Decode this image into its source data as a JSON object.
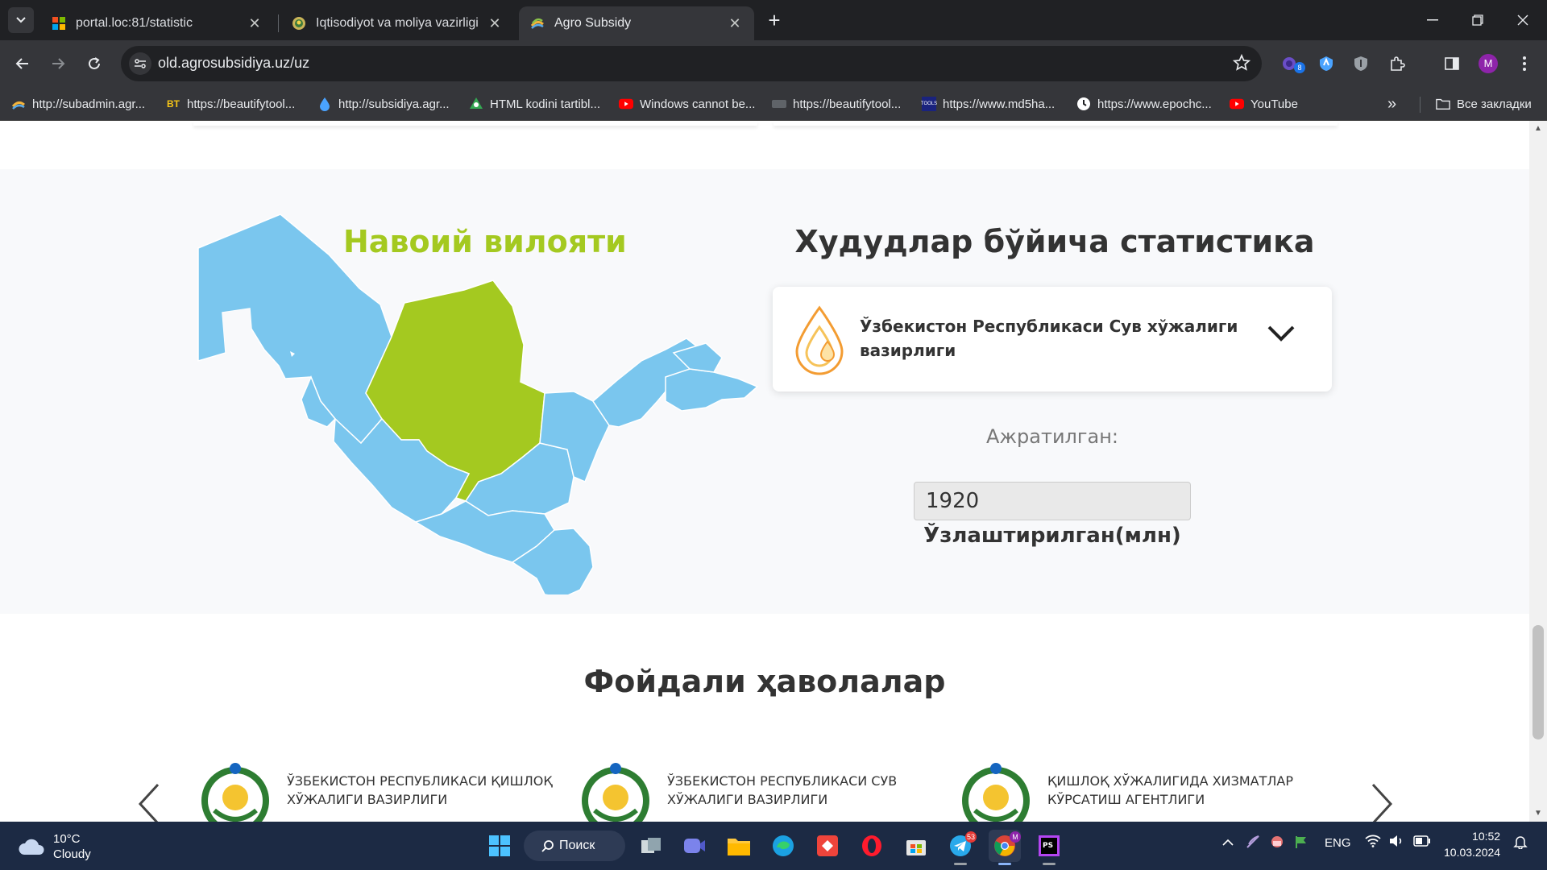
{
  "browser": {
    "tabs": [
      {
        "title": "portal.loc:81/statistic",
        "active": false
      },
      {
        "title": "Iqtisodiyot va moliya vazirligi",
        "active": false
      },
      {
        "title": "Agro Subsidy",
        "active": true
      }
    ],
    "url": "old.agrosubsidiya.uz/uz",
    "profile_initial": "M",
    "extension_badge": "8",
    "bookmarks": [
      {
        "label": "http://subadmin.agr..."
      },
      {
        "label": "https://beautifytool..."
      },
      {
        "label": "http://subsidiya.agr..."
      },
      {
        "label": "HTML kodini tartibl..."
      },
      {
        "label": "Windows cannot be..."
      },
      {
        "label": "https://beautifytool..."
      },
      {
        "label": "https://www.md5ha..."
      },
      {
        "label": "https://www.epochc..."
      },
      {
        "label": "YouTube"
      }
    ],
    "all_bookmarks_label": "Все закладки"
  },
  "stats": {
    "region_name": "Навоий вилояти",
    "title": "Худудлар бўйича статистика",
    "organization": "Ўзбекистон Республикаси Сув хўжалиги вазирлиги",
    "allocated_label": "Ажратилган:",
    "allocated_value": "1920",
    "developed_label": "Ўзлаштирилган(млн)",
    "colors": {
      "highlight": "#a4c920",
      "region": "#7ac6ee"
    }
  },
  "links": {
    "title": "Фойдали ҳаволалар",
    "items": [
      {
        "label": "Ўзбекистон Республикаси Қишлоқ хўжалиги вазирлиги"
      },
      {
        "label": "Ўзбекистон Республикаси Сув хўжалиги вазирлиги"
      },
      {
        "label": "Қишлоқ хўжалигида хизматлар кўрсатиш агентлиги"
      }
    ]
  },
  "taskbar": {
    "weather_temp": "10°C",
    "weather_desc": "Cloudy",
    "search_label": "Поиск",
    "telegram_badge": "53",
    "chrome_badge": "M",
    "language": "ENG",
    "time": "10:52",
    "date": "10.03.2024"
  }
}
